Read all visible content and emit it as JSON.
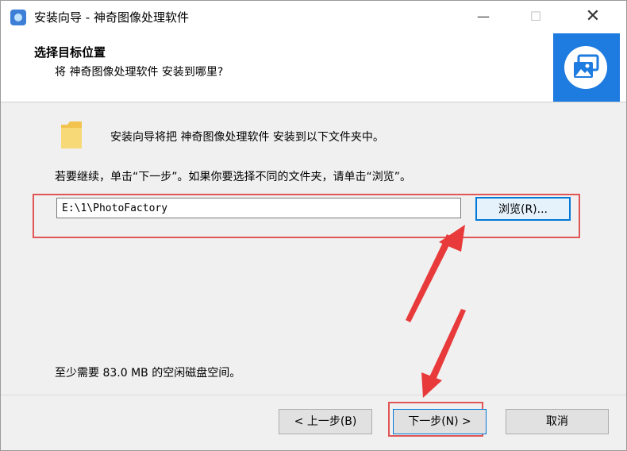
{
  "window": {
    "title": "安装向导 - 神奇图像处理软件",
    "minimize_glyph": "—",
    "maximize_glyph": "☐",
    "close_glyph": "✕"
  },
  "header": {
    "title": "选择目标位置",
    "subtitle": "将 神奇图像处理软件 安装到哪里?",
    "logo_icon": "photo-gallery-icon",
    "logo_color": "#1e7be0"
  },
  "body": {
    "folder_icon": "folder-icon",
    "intro": "安装向导将把 神奇图像处理软件 安装到以下文件夹中。",
    "instruction": "若要继续，单击“下一步”。如果你要选择不同的文件夹，请单击“浏览”。",
    "install_path": "E:\\1\\PhotoFactory",
    "browse_label": "浏览(R)...",
    "space_required": "至少需要 83.0 MB 的空闲磁盘空间。"
  },
  "footer": {
    "back_label": "< 上一步(B)",
    "next_label": "下一步(N) >",
    "cancel_label": "取消"
  },
  "annotation": {
    "highlight_color": "#e05555"
  }
}
